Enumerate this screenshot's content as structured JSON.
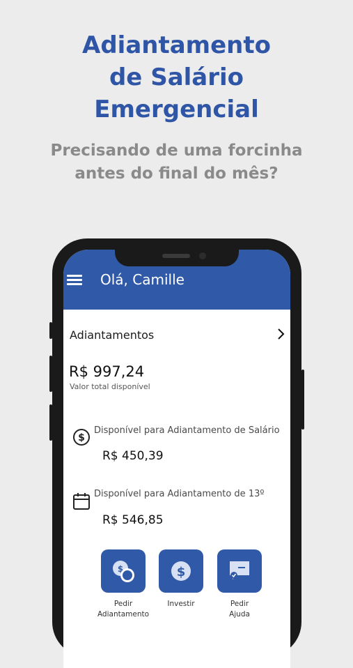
{
  "headline": {
    "line1": "Adiantamento",
    "line2": "de Salário",
    "line3": "Emergencial"
  },
  "subheadline": {
    "line1": "Precisando de uma forcinha",
    "line2": "antes do final do mês?"
  },
  "app": {
    "greeting": "Olá, Camille",
    "section_title": "Adiantamentos",
    "total_value": "R$ 997,24",
    "total_label": "Valor total disponível",
    "rows": [
      {
        "icon": "dollar-circle-icon",
        "label": "Disponível para Adiantamento de Salário",
        "value": "R$ 450,39"
      },
      {
        "icon": "calendar-icon",
        "label": "Disponível para Adiantamento de 13º",
        "value": "R$ 546,85"
      }
    ],
    "actions": [
      {
        "icon": "coins-icon",
        "line1": "Pedir",
        "line2": "Adiantamento"
      },
      {
        "icon": "dollar-circle-icon",
        "line1": "Investir",
        "line2": ""
      },
      {
        "icon": "help-chat-icon",
        "line1": "Pedir",
        "line2": "Ajuda"
      }
    ]
  },
  "colors": {
    "brand_blue": "#3059a8",
    "headline_blue": "#2f56a6",
    "subtitle_gray": "#8a8a8a",
    "background": "#ececec"
  }
}
